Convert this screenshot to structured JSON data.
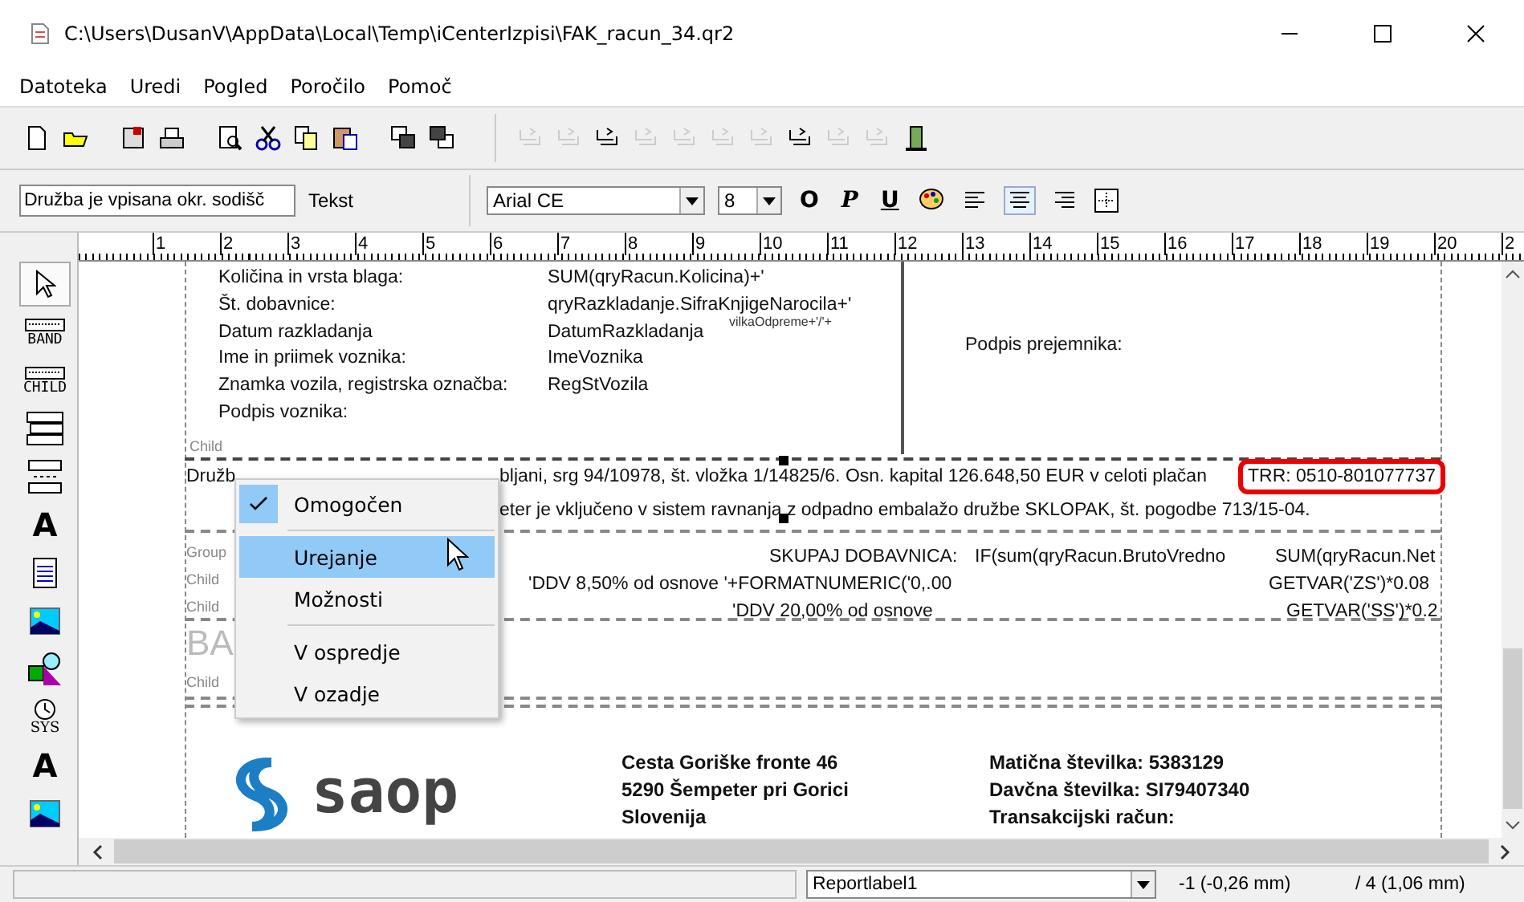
{
  "window": {
    "title": "C:\\Users\\DusanV\\AppData\\Local\\Temp\\iCenterIzpisi\\FAK_racun_34.qr2"
  },
  "menu": [
    "Datoteka",
    "Uredi",
    "Pogled",
    "Poročilo",
    "Pomoč"
  ],
  "toolbar": [
    {
      "disabled": false
    },
    {
      "disabled": false
    },
    {
      "disabled": false
    },
    {
      "disabled": false
    },
    {
      "disabled": false
    },
    {
      "disabled": false
    },
    {
      "disabled": false
    },
    {
      "disabled": false
    },
    {
      "disabled": false
    },
    {
      "disabled": false
    },
    {
      "disabled": true
    },
    {
      "disabled": true
    },
    {
      "disabled": false
    },
    {
      "disabled": true
    },
    {
      "disabled": true
    },
    {
      "disabled": true
    },
    {
      "disabled": true
    },
    {
      "disabled": false
    },
    {
      "disabled": true
    },
    {
      "disabled": true
    },
    {
      "disabled": false
    }
  ],
  "format_bar": {
    "text_value": "Družba je vpisana okr. sodišč",
    "label": "Tekst",
    "font": "Arial CE",
    "size": "8",
    "style_buttons": [
      "O",
      "P",
      "U"
    ],
    "align_buttons": [
      {
        "selected": false
      },
      {
        "selected": true
      },
      {
        "selected": false
      }
    ]
  },
  "ruler": [
    "1",
    "2",
    "3",
    "4",
    "5",
    "6",
    "7",
    "8",
    "9",
    "10",
    "11",
    "12",
    "13",
    "14",
    "15",
    "16",
    "17",
    "18",
    "19",
    "20",
    "2"
  ],
  "tools": [
    {
      "kind": "pointer",
      "selected": true
    },
    {
      "kind": "band",
      "label": "BAND",
      "selected": false
    },
    {
      "kind": "child",
      "label": "CHILD",
      "selected": false
    },
    {
      "kind": "group",
      "selected": false
    },
    {
      "kind": "subdetail",
      "selected": false
    },
    {
      "kind": "label",
      "label": "A",
      "selected": false
    },
    {
      "kind": "memo",
      "selected": false
    },
    {
      "kind": "image",
      "selected": false
    },
    {
      "kind": "shape",
      "selected": false
    },
    {
      "kind": "sysdata",
      "label": "SYS",
      "selected": false
    },
    {
      "kind": "dbtext",
      "label": "A",
      "selected": false
    },
    {
      "kind": "dbimage",
      "selected": false
    }
  ],
  "canvas": {
    "items": [
      {
        "kind": "text",
        "text": "Količina in vrsta blaga:"
      },
      {
        "kind": "text",
        "text": "Št. dobavnice:"
      },
      {
        "kind": "text",
        "text": "Datum razkladanja"
      },
      {
        "kind": "text",
        "text": "Ime in priimek voznika:"
      },
      {
        "kind": "text",
        "text": "Znamka vozila, registrska označba:"
      },
      {
        "kind": "text",
        "text": "Podpis voznika:"
      },
      {
        "kind": "band",
        "text": "Child"
      },
      {
        "kind": "text",
        "text": "SUM(qryRacun.Kolicina)+'"
      },
      {
        "kind": "text",
        "text": "qryRazkladanje.SifraKnjigeNarocila+'"
      },
      {
        "kind": "text",
        "text": "DatumRazkladanja"
      },
      {
        "kind": "small",
        "text": "vilkaOdpreme+'/'+"
      },
      {
        "kind": "text",
        "text": "ImeVoznika"
      },
      {
        "kind": "text",
        "text": "RegStVozila"
      },
      {
        "kind": "text",
        "text": "Podpis prejemnika:"
      },
      {
        "kind": "text",
        "text": "Družb"
      },
      {
        "kind": "text",
        "text": "bljani, srg 94/10978, št. vložka 1/14825/6. Osn. kapital 126.648,50 EUR v celoti plačan"
      },
      {
        "kind": "highlight",
        "text": "TRR: 0510-801077737"
      },
      {
        "kind": "text",
        "text": "eter je vključeno v sistem ravnanja z odpadno embalažo družbe SKLOPAK, št. pogodbe 713/15-04."
      },
      {
        "kind": "band",
        "text": "Group"
      },
      {
        "kind": "band",
        "text": "Child"
      },
      {
        "kind": "band",
        "text": "Child"
      },
      {
        "kind": "text",
        "text": "SKUPAJ DOBAVNICA:"
      },
      {
        "kind": "text",
        "text": "IF(sum(qryRacun.BrutoVredno"
      },
      {
        "kind": "text",
        "text": "SUM(qryRacun.Net"
      },
      {
        "kind": "text",
        "text": "'DDV 8,50% od osnove '+FORMATNUMERIC('0,.00"
      },
      {
        "kind": "text",
        "text": "GETVAR('ZS')*0.08"
      },
      {
        "kind": "text",
        "text": "'DDV 20,00% od osnove"
      },
      {
        "kind": "text",
        "text": "GETVAR('SS')*0.2"
      },
      {
        "kind": "faint",
        "text": "BA"
      },
      {
        "kind": "band",
        "text": "Child"
      },
      {
        "kind": "bold",
        "text": "Cesta Goriške fronte 46"
      },
      {
        "kind": "bold",
        "text": "5290 Šempeter pri Gorici"
      },
      {
        "kind": "bold",
        "text": "Slovenija"
      },
      {
        "kind": "bold",
        "text": "Matična številka: 5383129"
      },
      {
        "kind": "bold",
        "text": "Davčna številka: SI79407340"
      },
      {
        "kind": "bold",
        "text": "Transakcijski račun:"
      }
    ],
    "logo_text": "saop"
  },
  "context_menu": {
    "items": [
      {
        "kind": "item",
        "label": "Omogočen",
        "checked": true,
        "selected": false
      },
      {
        "kind": "separator"
      },
      {
        "kind": "item",
        "label": "Urejanje",
        "checked": false,
        "selected": true
      },
      {
        "kind": "item",
        "label": "Možnosti",
        "checked": false,
        "selected": false
      },
      {
        "kind": "separator"
      },
      {
        "kind": "item",
        "label": "V ospredje",
        "checked": false,
        "selected": false
      },
      {
        "kind": "item",
        "label": "V ozadje",
        "checked": false,
        "selected": false
      }
    ]
  },
  "status_bar": {
    "component": "Reportlabel1",
    "x_position": "-1 (-0,26 mm)",
    "y_position": "/ 4 (1,06 mm)"
  }
}
